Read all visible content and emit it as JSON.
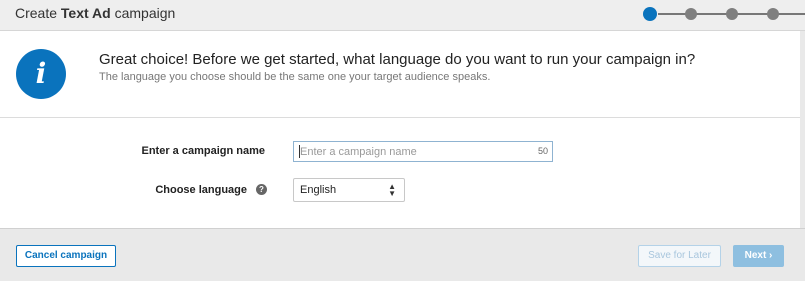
{
  "header": {
    "title_prefix": "Create ",
    "title_bold": "Text Ad",
    "title_suffix": " campaign",
    "steps_total": 4,
    "steps_current": 1,
    "accent_color": "#0a73bd"
  },
  "info": {
    "icon": "info-icon",
    "icon_glyph": "i",
    "heading": "Great choice! Before we get started, what language do you want to run your campaign in?",
    "subtext": "The language you choose should be the same one your target audience speaks."
  },
  "form": {
    "name_label": "Enter a campaign name",
    "name_placeholder": "Enter a campaign name",
    "name_value": "",
    "name_char_count": "50",
    "language_label": "Choose language",
    "help_glyph": "?",
    "language_value": "English"
  },
  "footer": {
    "cancel_label": "Cancel campaign",
    "save_label": "Save for Later",
    "next_label": "Next ›"
  }
}
